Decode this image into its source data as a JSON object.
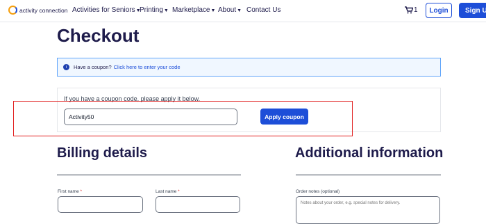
{
  "nav": {
    "logo_text": "activity connection",
    "links": [
      {
        "label": "Activities for Seniors",
        "dropdown": true
      },
      {
        "label": "Printing",
        "dropdown": true
      },
      {
        "label": "Marketplace",
        "dropdown": true
      },
      {
        "label": "About",
        "dropdown": true
      },
      {
        "label": "Contact Us",
        "dropdown": false
      }
    ],
    "cart_icon": "cart-icon",
    "cart_count": "1",
    "login_label": "Login",
    "signup_label": "Sign Up"
  },
  "page": {
    "title": "Checkout"
  },
  "coupon_notice": {
    "icon": "info-icon",
    "text": "Have a coupon?",
    "link": "Click here to enter your code"
  },
  "coupon_form": {
    "hint": "If you have a coupon code, please apply it below.",
    "input_value": "Activity50",
    "apply_label": "Apply coupon"
  },
  "billing": {
    "title": "Billing details",
    "first_name_label": "First name",
    "last_name_label": "Last name",
    "required_mark": "*"
  },
  "additional": {
    "title": "Additional information",
    "notes_label": "Order notes (optional)",
    "notes_placeholder": "Notes about your order, e.g. special notes for delivery."
  },
  "colors": {
    "brand_blue": "#1d4ed8",
    "title_navy": "#1e1b4b",
    "highlight_red": "#e11d1d"
  }
}
